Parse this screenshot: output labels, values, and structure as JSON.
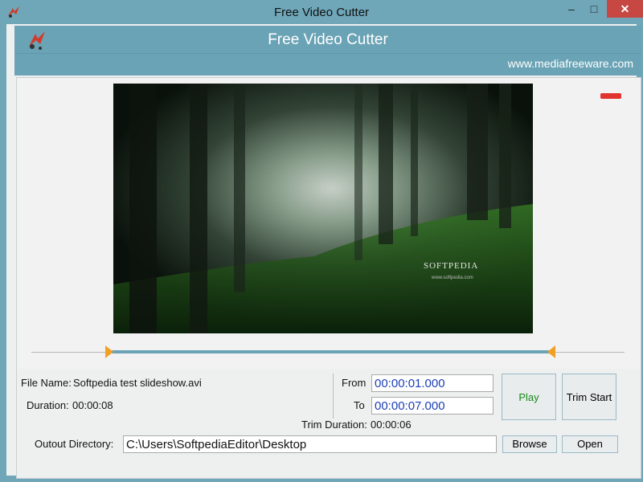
{
  "window": {
    "title": "Free Video Cutter",
    "min": "–",
    "max": "□",
    "close": "✕"
  },
  "banner": {
    "title": "Free Video Cutter",
    "site": "www.mediafreeware.com"
  },
  "video": {
    "watermark": "SOFTPEDIA",
    "watermark_url": "www.softpedia.com"
  },
  "info": {
    "file_name_label": "File Name:",
    "file_name": "Softpedia test slideshow.avi",
    "duration_label": "Duration:",
    "duration": "00:00:08",
    "from_label": "From",
    "from_value": "00:00:01.000",
    "to_label": "To",
    "to_value": "00:00:07.000",
    "trim_duration_label": "Trim Duration:",
    "trim_duration": "00:00:06"
  },
  "buttons": {
    "play": "Play",
    "trim_start": "Trim Start",
    "browse": "Browse",
    "open": "Open"
  },
  "output": {
    "label": "Outout Directory:",
    "path": "C:\\Users\\SoftpediaEditor\\Desktop"
  },
  "colors": {
    "accent": "#6aa3b5",
    "marker": "#f2a024",
    "time_text": "#1b3fb5",
    "play_text": "#1a8a1a",
    "close_button": "#c74843"
  }
}
